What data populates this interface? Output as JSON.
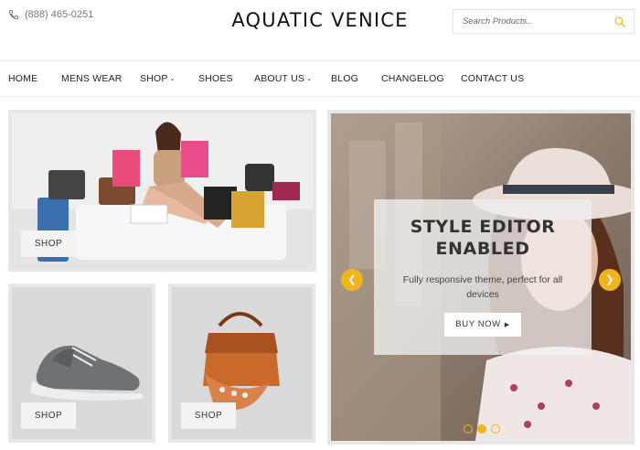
{
  "header": {
    "phone": "(888) 465-0251",
    "logo": "AQUATIC VENICE",
    "search_placeholder": "Search Products.."
  },
  "nav": {
    "items": [
      {
        "label": "HOME",
        "dropdown": false
      },
      {
        "label": "MENS WEAR",
        "dropdown": false
      },
      {
        "label": "SHOP",
        "dropdown": true
      },
      {
        "label": "SHOES",
        "dropdown": false
      },
      {
        "label": "ABOUT US",
        "dropdown": true
      },
      {
        "label": "BLOG",
        "dropdown": false
      },
      {
        "label": "CHANGELOG",
        "dropdown": false
      },
      {
        "label": "CONTACT US",
        "dropdown": false
      }
    ]
  },
  "tiles": {
    "main_shop": "SHOP",
    "shoe_shop": "SHOP",
    "bag_shop": "SHOP"
  },
  "slider": {
    "title_line1": "STYLE EDITOR",
    "title_line2": "ENABLED",
    "subtitle": "Fully responsive theme, perfect for all devices",
    "button": "BUY NOW",
    "dots": 3,
    "active_dot": 2
  },
  "colors": {
    "accent": "#f0b51e",
    "text": "#222222",
    "border": "#e7e7e7"
  },
  "icons": [
    "phone-icon",
    "search-icon",
    "chevron-left-icon",
    "chevron-right-icon",
    "play-triangle-icon"
  ]
}
